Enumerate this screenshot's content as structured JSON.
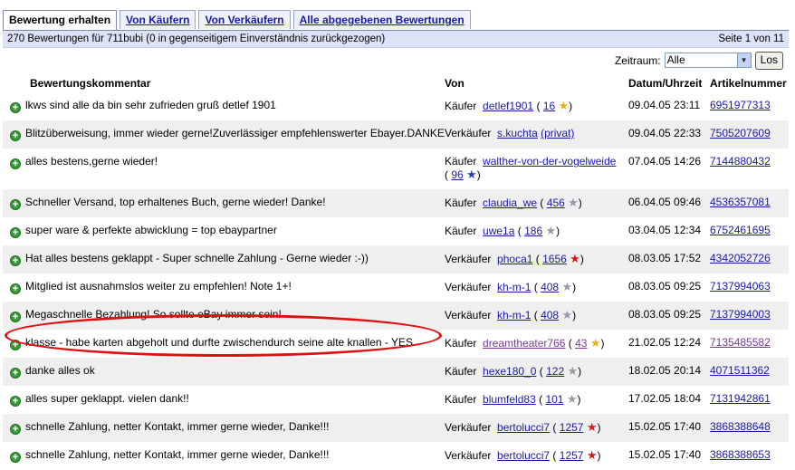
{
  "tabs": [
    {
      "label": "Bewertung erhalten",
      "active": true
    },
    {
      "label": "Von Käufern",
      "active": false
    },
    {
      "label": "Von Verkäufern",
      "active": false
    },
    {
      "label": "Alle abgegebenen Bewertungen",
      "active": false
    }
  ],
  "summary": {
    "text": "270 Bewertungen für 711bubi (0 in gegenseitigem Einverständnis zurückgezogen)",
    "page": "Seite 1 von 11"
  },
  "filter": {
    "label": "Zeitraum:",
    "selected": "Alle",
    "button": "Los"
  },
  "columns": {
    "comment": "Bewertungskommentar",
    "from": "Von",
    "date": "Datum/Uhrzeit",
    "item": "Artikelnummer"
  },
  "rows": [
    {
      "comment": "lkws sind alle da bin sehr zufrieden gruß detlef 1901",
      "role": "Käufer",
      "user": "detlef1901",
      "open": "(",
      "score": "16",
      "close": ")",
      "star": "★",
      "starColor": "#e8b020",
      "date": "09.04.05 23:11",
      "item": "6951977313"
    },
    {
      "comment": "Blitzüberweisung, immer wieder gerne!Zuverlässiger empfehlenswerter Ebayer.DANKE",
      "role": "Verkäufer",
      "user": "s.kuchta",
      "open": "",
      "score": "",
      "close": "",
      "private": "(privat)",
      "star": "",
      "starColor": "",
      "date": "09.04.05 22:33",
      "item": "7505207609"
    },
    {
      "comment": "alles bestens,gerne wieder!",
      "role": "Käufer",
      "user": "walther-von-der-vogelweide",
      "open": "(",
      "score": "96",
      "close": ")",
      "star": "★",
      "starColor": "#2e3ea8",
      "date": "07.04.05 14:26",
      "item": "7144880432"
    },
    {
      "comment": "Schneller Versand, top erhaltenes Buch, gerne wieder! Danke!",
      "role": "Käufer",
      "user": "claudia_we",
      "open": "(",
      "score": "456",
      "close": ")",
      "star": "★",
      "starColor": "#9a9aa6",
      "date": "06.04.05 09:46",
      "item": "4536357081"
    },
    {
      "comment": "super ware & perfekte abwicklung = top ebaypartner",
      "role": "Käufer",
      "user": "uwe1a",
      "open": "(",
      "score": "186",
      "close": ")",
      "star": "★",
      "starColor": "#9a9aa6",
      "date": "03.04.05 12:34",
      "item": "6752461695"
    },
    {
      "comment": "Hat alles bestens geklappt - Super schnelle Zahlung - Gerne wieder :-))",
      "role": "Verkäufer",
      "user": "phoca1",
      "open": "(",
      "score": "1656",
      "close": ")",
      "star": "★",
      "starColor": "#d81818",
      "date": "08.03.05 17:52",
      "item": "4342052726"
    },
    {
      "comment": "Mitglied ist ausnahmslos weiter zu empfehlen! Note 1+!",
      "role": "Verkäufer",
      "user": "kh-m-1",
      "open": "(",
      "score": "408",
      "close": ")",
      "star": "★",
      "starColor": "#9a9aa6",
      "date": "08.03.05 09:25",
      "item": "7137994063"
    },
    {
      "comment": "Megaschnelle Bezahlung! So sollte eBay immer sein!",
      "role": "Verkäufer",
      "user": "kh-m-1",
      "open": "(",
      "score": "408",
      "close": ")",
      "star": "★",
      "starColor": "#9a9aa6",
      "date": "08.03.05 09:25",
      "item": "7137994003"
    },
    {
      "comment": "klasse - habe karten abgeholt und durfte zwischendurch seine alte knallen - YES",
      "role": "Käufer",
      "user": "dreamtheater766",
      "open": "(",
      "score": "43",
      "close": ")",
      "star": "★",
      "starColor": "#e8b020",
      "date": "21.02.05 12:24",
      "item": "7135485582"
    },
    {
      "comment": "danke alles ok",
      "role": "Käufer",
      "user": "hexe180_0",
      "open": "(",
      "score": "122",
      "close": ")",
      "star": "★",
      "starColor": "#9a9aa6",
      "date": "18.02.05 20:14",
      "item": "4071511362"
    },
    {
      "comment": "alles super geklappt. vielen dank!!",
      "role": "Käufer",
      "user": "blumfeld83",
      "open": "(",
      "score": "101",
      "close": ")",
      "star": "★",
      "starColor": "#9a9aa6",
      "date": "17.02.05 18:04",
      "item": "7131942861"
    },
    {
      "comment": "schnelle Zahlung, netter Kontakt, immer gerne wieder, Danke!!!",
      "role": "Verkäufer",
      "user": "bertolucci7",
      "open": "(",
      "score": "1257",
      "close": ")",
      "star": "★",
      "starColor": "#d81818",
      "date": "15.02.05 17:40",
      "item": "3868388648"
    },
    {
      "comment": "schnelle Zahlung, netter Kontakt, immer gerne wieder, Danke!!!",
      "role": "Verkäufer",
      "user": "bertolucci7",
      "open": "(",
      "score": "1257",
      "close": ")",
      "star": "★",
      "starColor": "#d81818",
      "date": "15.02.05 17:40",
      "item": "3868388653"
    }
  ]
}
